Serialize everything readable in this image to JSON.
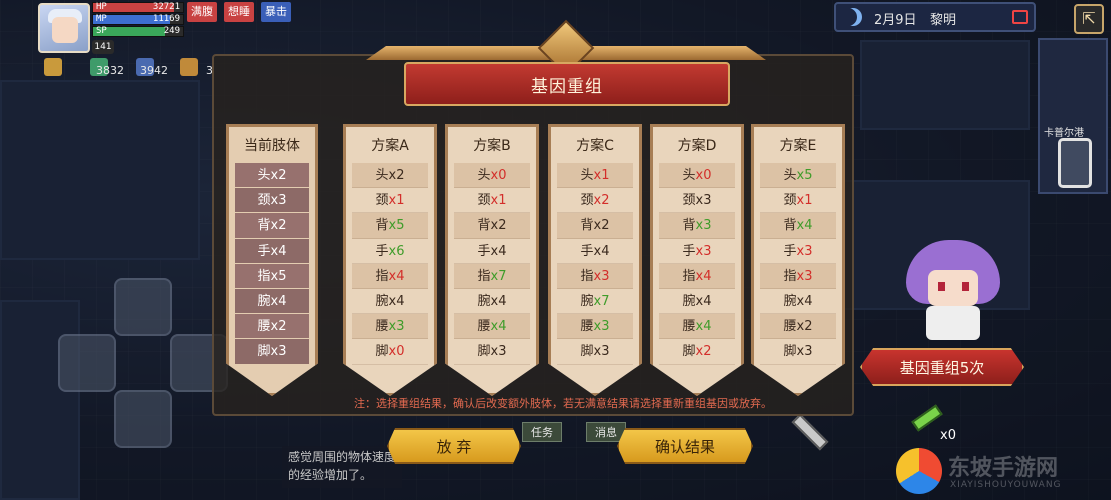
{
  "hud": {
    "hp_label": "HP",
    "hp_value": "32721",
    "hp_fraction": 0.9,
    "mp_label": "MP",
    "mp_value": "11169",
    "mp_fraction": 0.85,
    "sp_label": "SP",
    "sp_value": "249",
    "sp_fraction": 0.8,
    "level": "141",
    "status_chips": [
      "满腹",
      "想睡",
      "暴击"
    ],
    "resources": [
      "3832",
      "3942",
      "3"
    ]
  },
  "clock": {
    "date": "2月9日",
    "phase": "黎明"
  },
  "map": {
    "location": "卡普尔港"
  },
  "panel": {
    "title": "基因重组",
    "current_header": "当前肢体",
    "current_rows": [
      "头x2",
      "颈x3",
      "背x2",
      "手x4",
      "指x5",
      "腕x4",
      "腰x2",
      "脚x3"
    ],
    "plans": [
      {
        "header": "方案A",
        "rows": [
          {
            "part": "头",
            "n": "x2",
            "c": "plain"
          },
          {
            "part": "颈",
            "n": "x1",
            "c": "red"
          },
          {
            "part": "背",
            "n": "x5",
            "c": "green"
          },
          {
            "part": "手",
            "n": "x6",
            "c": "green"
          },
          {
            "part": "指",
            "n": "x4",
            "c": "red"
          },
          {
            "part": "腕",
            "n": "x4",
            "c": "plain"
          },
          {
            "part": "腰",
            "n": "x3",
            "c": "green"
          },
          {
            "part": "脚",
            "n": "x0",
            "c": "red"
          }
        ]
      },
      {
        "header": "方案B",
        "rows": [
          {
            "part": "头",
            "n": "x0",
            "c": "red"
          },
          {
            "part": "颈",
            "n": "x1",
            "c": "red"
          },
          {
            "part": "背",
            "n": "x2",
            "c": "plain"
          },
          {
            "part": "手",
            "n": "x4",
            "c": "plain"
          },
          {
            "part": "指",
            "n": "x7",
            "c": "green"
          },
          {
            "part": "腕",
            "n": "x4",
            "c": "plain"
          },
          {
            "part": "腰",
            "n": "x4",
            "c": "green"
          },
          {
            "part": "脚",
            "n": "x3",
            "c": "plain"
          }
        ]
      },
      {
        "header": "方案C",
        "rows": [
          {
            "part": "头",
            "n": "x1",
            "c": "red"
          },
          {
            "part": "颈",
            "n": "x2",
            "c": "red"
          },
          {
            "part": "背",
            "n": "x2",
            "c": "plain"
          },
          {
            "part": "手",
            "n": "x4",
            "c": "plain"
          },
          {
            "part": "指",
            "n": "x3",
            "c": "red"
          },
          {
            "part": "腕",
            "n": "x7",
            "c": "green"
          },
          {
            "part": "腰",
            "n": "x3",
            "c": "green"
          },
          {
            "part": "脚",
            "n": "x3",
            "c": "plain"
          }
        ]
      },
      {
        "header": "方案D",
        "rows": [
          {
            "part": "头",
            "n": "x0",
            "c": "red"
          },
          {
            "part": "颈",
            "n": "x3",
            "c": "plain"
          },
          {
            "part": "背",
            "n": "x3",
            "c": "green"
          },
          {
            "part": "手",
            "n": "x3",
            "c": "red"
          },
          {
            "part": "指",
            "n": "x4",
            "c": "red"
          },
          {
            "part": "腕",
            "n": "x4",
            "c": "plain"
          },
          {
            "part": "腰",
            "n": "x4",
            "c": "green"
          },
          {
            "part": "脚",
            "n": "x2",
            "c": "red"
          }
        ]
      },
      {
        "header": "方案E",
        "rows": [
          {
            "part": "头",
            "n": "x5",
            "c": "green"
          },
          {
            "part": "颈",
            "n": "x1",
            "c": "red"
          },
          {
            "part": "背",
            "n": "x4",
            "c": "green"
          },
          {
            "part": "手",
            "n": "x3",
            "c": "red"
          },
          {
            "part": "指",
            "n": "x3",
            "c": "red"
          },
          {
            "part": "腕",
            "n": "x4",
            "c": "plain"
          },
          {
            "part": "腰",
            "n": "x2",
            "c": "plain"
          },
          {
            "part": "脚",
            "n": "x3",
            "c": "plain"
          }
        ]
      }
    ],
    "note": "注：选择重组结果，确认后改变额外肢体，若无满意结果请选择重新重组基因或放弃。",
    "abandon_label": "放 弃",
    "confirm_label": "确认结果"
  },
  "recombine_banner": "基因重组5次",
  "syringe_count": "x0",
  "bottom": {
    "tab_task": "任务",
    "tab_message": "消息",
    "chat": "感觉周围的物体速度的经验增加了。"
  },
  "watermark": {
    "text": "东坡手游网",
    "sub": "XIAYISHOUYOUWANG"
  },
  "colors": {
    "increase": "#3f9c2a",
    "decrease": "#d32e2a",
    "banner": "#c23a31",
    "button": "#f3c648"
  }
}
